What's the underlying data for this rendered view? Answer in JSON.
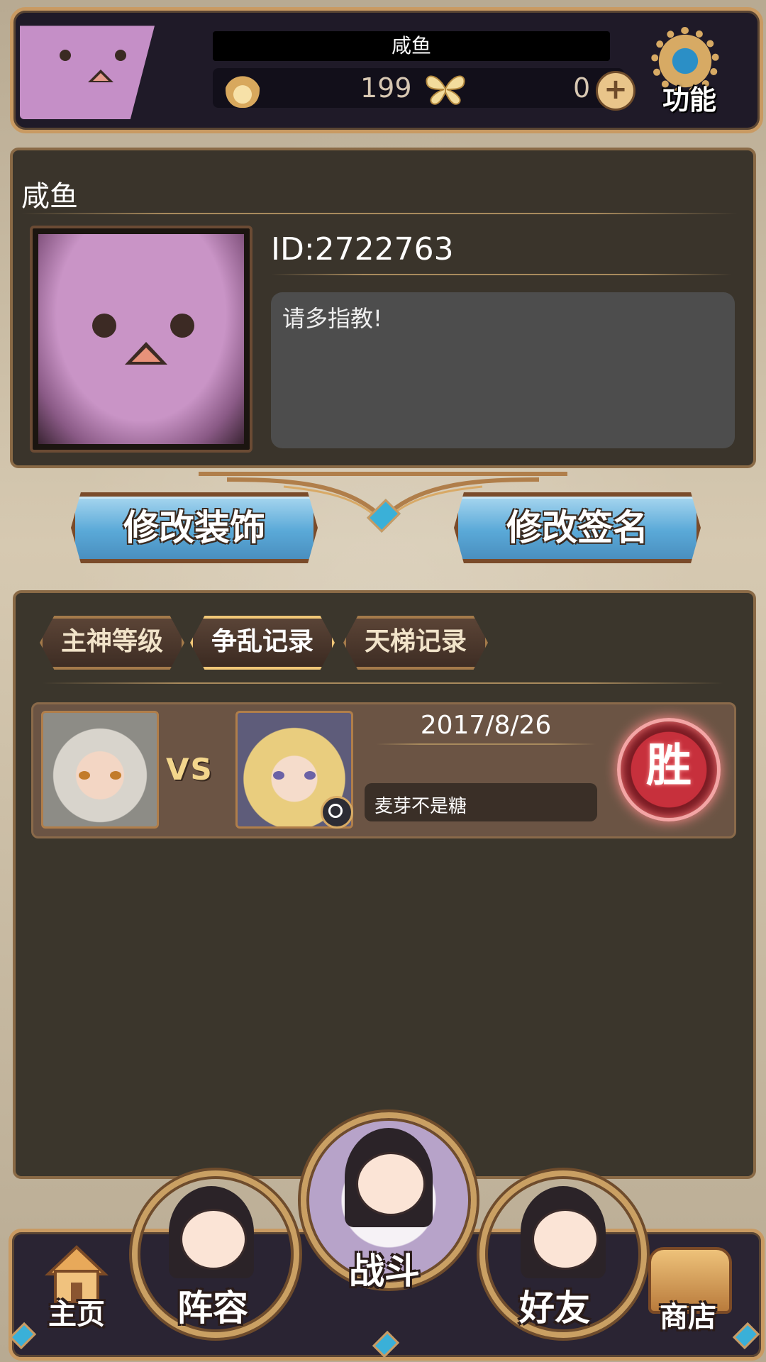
{
  "header": {
    "player_name": "咸鱼",
    "currency_main": "199",
    "currency_secondary": "0",
    "function_label": "功能",
    "plus_label": "+"
  },
  "profile": {
    "name": "咸鱼",
    "id_text": "ID:2722763",
    "signature": "请多指教!"
  },
  "actions": {
    "edit_decoration": "修改装饰",
    "edit_signature": "修改签名"
  },
  "tabs": [
    {
      "label": "主神等级",
      "active": false
    },
    {
      "label": "争乱记录",
      "active": true
    },
    {
      "label": "天梯记录",
      "active": false
    }
  ],
  "records": [
    {
      "vs_label": "VS",
      "date": "2017/8/26",
      "opponent": "麦芽不是糖",
      "result": "胜"
    }
  ],
  "nav": {
    "home": "主页",
    "lineup": "阵容",
    "battle": "战斗",
    "friends": "好友",
    "shop": "商店"
  },
  "colors": {
    "frame_gold": "#c99a62",
    "panel_bg": "#3a342b",
    "button_blue": "#5aa9d8",
    "win_red": "#c7303c",
    "gem_blue": "#3ab0d8"
  }
}
